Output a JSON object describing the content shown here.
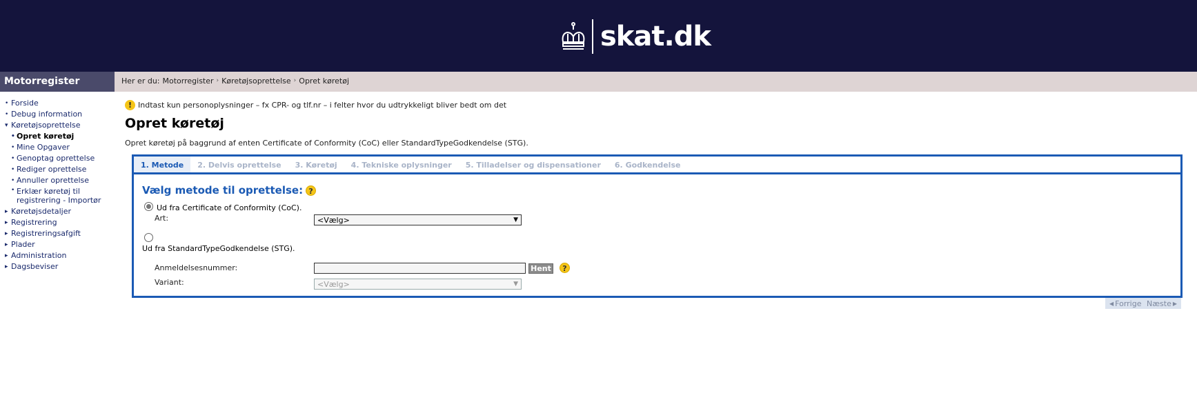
{
  "header": {
    "brand": "skat.dk"
  },
  "nav": {
    "title": "Motorregister",
    "items": [
      {
        "label": "Forside"
      },
      {
        "label": "Debug information"
      },
      {
        "label": "Køretøjsoprettelse"
      },
      {
        "label": "Opret køretøj"
      },
      {
        "label": "Mine Opgaver"
      },
      {
        "label": "Genoptag oprettelse"
      },
      {
        "label": "Rediger oprettelse"
      },
      {
        "label": "Annuller oprettelse"
      },
      {
        "label": "Erklær køretøj til registrering - Importør"
      },
      {
        "label": "Køretøjsdetaljer"
      },
      {
        "label": "Registrering"
      },
      {
        "label": "Registreringsafgift"
      },
      {
        "label": "Plader"
      },
      {
        "label": "Administration"
      },
      {
        "label": "Dagsbeviser"
      }
    ]
  },
  "breadcrumb": {
    "prefix": "Her er du:",
    "items": [
      "Motorregister",
      "Køretøjsoprettelse",
      "Opret køretøj"
    ]
  },
  "notice": "Indtast kun personoplysninger – fx CPR- og tlf.nr – i felter hvor du udtrykkeligt bliver bedt om det",
  "page": {
    "title": "Opret køretøj",
    "description": "Opret køretøj på baggrund af enten Certificate of Conformity (CoC) eller StandardTypeGodkendelse (STG)."
  },
  "wizard": {
    "tabs": [
      {
        "label": "1. Metode",
        "active": true
      },
      {
        "label": "2. Delvis oprettelse"
      },
      {
        "label": "3. Køretøj"
      },
      {
        "label": "4. Tekniske oplysninger"
      },
      {
        "label": "5. Tilladelser og dispensationer"
      },
      {
        "label": "6. Godkendelse"
      }
    ],
    "section_title": "Vælg metode til oprettelse:",
    "help_symbol": "?",
    "coc": {
      "label": "Ud fra Certificate of Conformity (CoC).",
      "art_label": "Art:",
      "art_value": "<Vælg>"
    },
    "stg": {
      "label": "Ud fra StandardTypeGodkendelse (STG).",
      "anmeldelse_label": "Anmeldelsesnummer:",
      "anmeldelse_value": "",
      "hent_label": "Hent",
      "variant_label": "Variant:",
      "variant_value": "<Vælg>"
    }
  },
  "pager": {
    "prev_label": "Forrige",
    "next_label": "Næste"
  },
  "warn_symbol": "!"
}
